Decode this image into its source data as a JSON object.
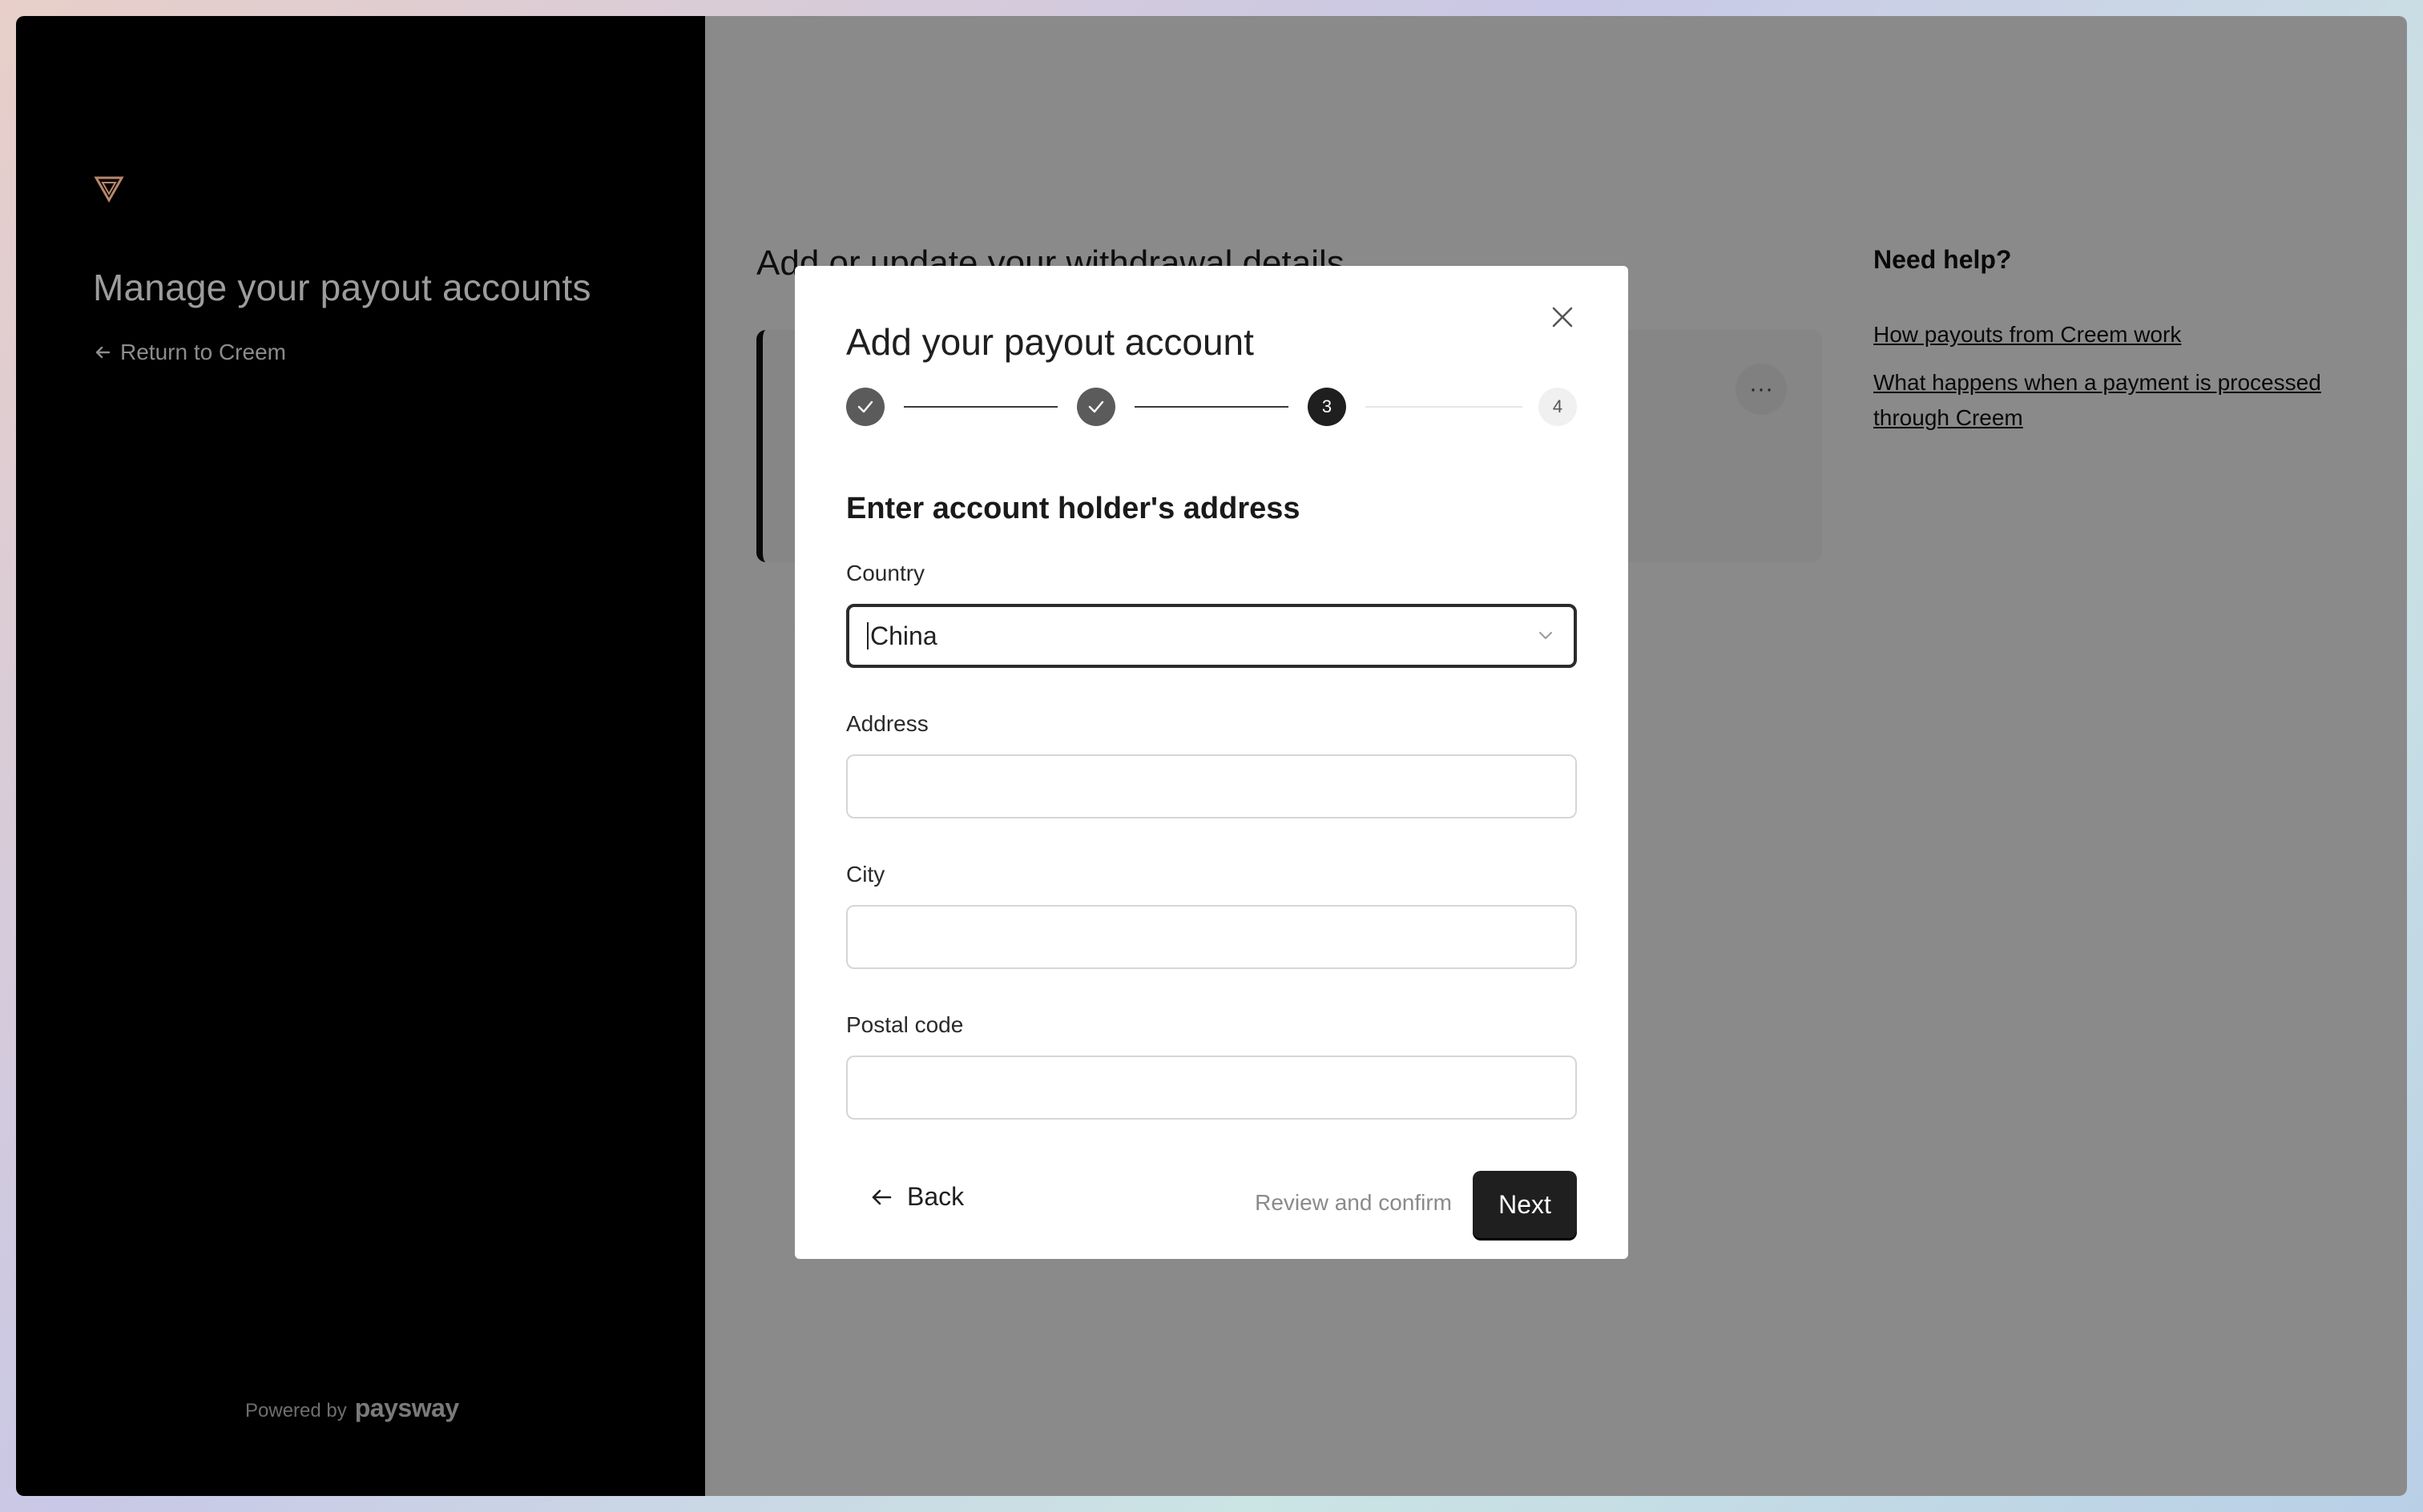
{
  "sidebar": {
    "heading": "Manage your payout accounts",
    "return_link": "Return to Creem",
    "powered_label": "Powered by",
    "powered_brand": "paysway"
  },
  "background": {
    "heading": "Add or update your withdrawal details",
    "more_label": "···",
    "plus_label": "+",
    "help_title": "Need help?",
    "help_links": [
      "How payouts from Creem work",
      "What happens when a payment is processed through Creem"
    ]
  },
  "modal": {
    "title": "Add your payout account",
    "steps": [
      {
        "label": "",
        "state": "done"
      },
      {
        "label": "",
        "state": "done"
      },
      {
        "label": "3",
        "state": "active"
      },
      {
        "label": "4",
        "state": "todo"
      }
    ],
    "section_title": "Enter account holder's address",
    "fields": {
      "country": {
        "label": "Country",
        "value": "China"
      },
      "address": {
        "label": "Address",
        "value": ""
      },
      "city": {
        "label": "City",
        "value": ""
      },
      "postal_code": {
        "label": "Postal code",
        "value": ""
      }
    },
    "footer": {
      "back_label": "Back",
      "review_label": "Review and confirm",
      "next_label": "Next"
    }
  },
  "colors": {
    "accent": "#1f1f1f",
    "logo": "#b8876a"
  },
  "icons": [
    "triangle-logo-icon",
    "arrow-left-icon",
    "close-icon",
    "check-icon",
    "chevron-down-icon",
    "more-icon",
    "plus-icon"
  ]
}
